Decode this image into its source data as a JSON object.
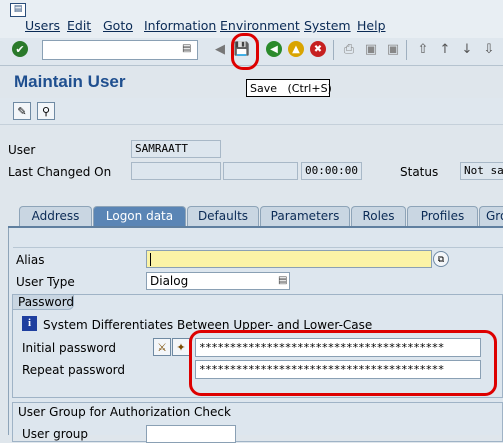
{
  "menubar": {
    "items": [
      "Users",
      "Edit",
      "Goto",
      "Information",
      "Environment",
      "System",
      "Help"
    ]
  },
  "toolbar": {
    "tooltip": "Save   (Ctrl+S)"
  },
  "page": {
    "title": "Maintain User"
  },
  "header": {
    "user_label": "User",
    "user_value": "SAMRAATT",
    "last_changed_label": "Last Changed On",
    "time_value": "00:00:00",
    "status_label": "Status",
    "status_value": "Not sa"
  },
  "tabs": [
    "Address",
    "Logon data",
    "Defaults",
    "Parameters",
    "Roles",
    "Profiles",
    "Gro"
  ],
  "logon": {
    "alias_label": "Alias",
    "user_type_label": "User Type",
    "user_type_value": "Dialog",
    "password_group": "Password",
    "info_text": "System Differentiates Between Upper- and Lower-Case",
    "initial_password_label": "Initial password",
    "repeat_password_label": "Repeat password",
    "initial_password_value": "****************************************",
    "repeat_password_value": "****************************************",
    "auth_group": "User Group for Authorization Check",
    "user_group_label": "User group"
  },
  "colors": {
    "highlight_circle": "#dd0000",
    "accent": "#1f4f8f"
  }
}
